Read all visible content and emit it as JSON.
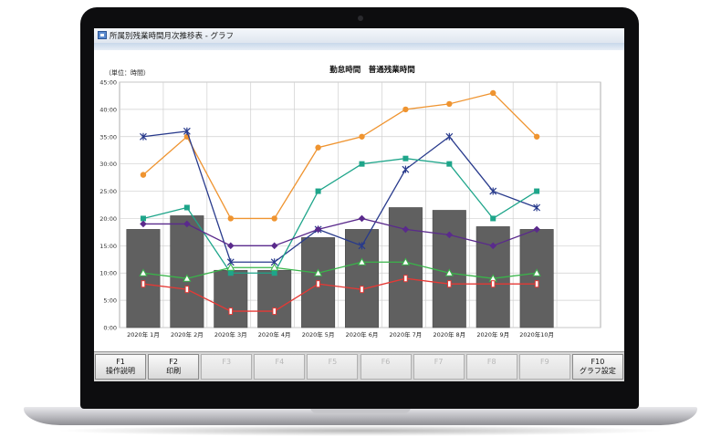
{
  "window": {
    "title": "所属別残業時間月次推移表 - グラフ"
  },
  "chart_data": {
    "type": "bar",
    "title": "勤怠時間　普通残業時間",
    "unit_label": "（単位：時間）",
    "categories": [
      "2020年 1月",
      "2020年 2月",
      "2020年 3月",
      "2020年 4月",
      "2020年 5月",
      "2020年 6月",
      "2020年 7月",
      "2020年 8月",
      "2020年 9月",
      "2020年10月"
    ],
    "ylim": [
      0,
      45
    ],
    "yticks": [
      "0:00",
      "5:00",
      "10:00",
      "15:00",
      "20:00",
      "25:00",
      "30:00",
      "35:00",
      "40:00",
      "45:00"
    ],
    "grid": true,
    "bars": {
      "color": "#606060",
      "values": [
        18,
        20.5,
        10.5,
        10.5,
        16.5,
        18,
        22,
        21.5,
        18.5,
        18
      ]
    },
    "series": [
      {
        "color": "#ef9430",
        "marker": "circle",
        "values": [
          28,
          35,
          20,
          20,
          33,
          35,
          40,
          41,
          43,
          35
        ]
      },
      {
        "color": "#283a8c",
        "marker": "star",
        "values": [
          35,
          36,
          12,
          12,
          18,
          15,
          29,
          35,
          25,
          22
        ]
      },
      {
        "color": "#1ea58a",
        "marker": "square",
        "values": [
          20,
          22,
          10,
          10,
          25,
          30,
          31,
          30,
          20,
          25
        ]
      },
      {
        "color": "#5a2a8c",
        "marker": "diamond",
        "values": [
          19,
          19,
          15,
          15,
          18,
          20,
          18,
          17,
          15,
          18
        ]
      },
      {
        "color": "#39b54a",
        "marker": "triangle",
        "values": [
          10,
          9,
          11,
          11,
          10,
          12,
          12,
          10,
          9,
          10
        ]
      },
      {
        "color": "#e53935",
        "marker": "rect",
        "values": [
          8,
          7,
          3,
          3,
          8,
          7,
          9,
          8,
          8,
          8
        ]
      }
    ]
  },
  "fkeys": [
    {
      "key": "F1",
      "label": "操作説明",
      "enabled": true
    },
    {
      "key": "F2",
      "label": "印刷",
      "enabled": true
    },
    {
      "key": "F3",
      "label": "",
      "enabled": false
    },
    {
      "key": "F4",
      "label": "",
      "enabled": false
    },
    {
      "key": "F5",
      "label": "",
      "enabled": false
    },
    {
      "key": "F6",
      "label": "",
      "enabled": false
    },
    {
      "key": "F7",
      "label": "",
      "enabled": false
    },
    {
      "key": "F8",
      "label": "",
      "enabled": false
    },
    {
      "key": "F9",
      "label": "",
      "enabled": false
    },
    {
      "key": "F10",
      "label": "グラフ設定",
      "enabled": true
    }
  ]
}
